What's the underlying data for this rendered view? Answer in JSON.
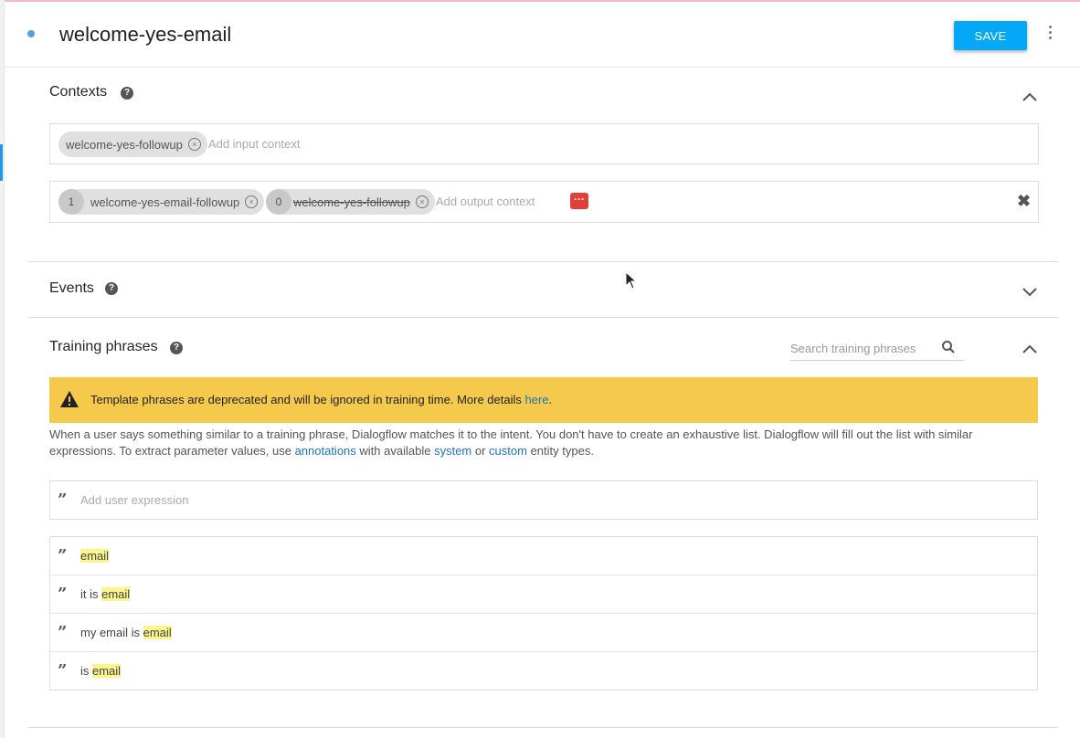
{
  "header": {
    "intent_name": "welcome-yes-email",
    "save_label": "SAVE",
    "more_icon": "more-vertical-icon"
  },
  "contexts": {
    "title": "Contexts",
    "input_contexts": [
      {
        "name": "welcome-yes-followup"
      }
    ],
    "input_placeholder": "Add input context",
    "output_contexts": [
      {
        "lifespan": "1",
        "name": "welcome-yes-email-followup",
        "strikethrough": false
      },
      {
        "lifespan": "0",
        "name": "welcome-yes-followup",
        "strikethrough": true
      }
    ],
    "output_placeholder": "Add output context",
    "more_button_icon": "ellipsis-icon",
    "clear_icon": "close-icon"
  },
  "events": {
    "title": "Events"
  },
  "training": {
    "title": "Training phrases",
    "search_placeholder": "Search training phrases",
    "warning": {
      "text": "Template phrases are deprecated and will be ignored in training time. More details ",
      "link": "here",
      "suffix": "."
    },
    "description": {
      "part1": "When a user says something similar to a training phrase, Dialogflow matches it to the intent. You don't have to create an exhaustive list. Dialogflow will fill out the list with similar expressions. To extract parameter values, use ",
      "link_annotations": "annotations",
      "part2": " with available ",
      "link_system": "system",
      "part3": " or ",
      "link_custom": "custom",
      "part4": " entity types."
    },
    "add_placeholder": "Add user expression",
    "phrases": [
      {
        "prefix": "",
        "highlight": "email"
      },
      {
        "prefix": "it is ",
        "highlight": "email"
      },
      {
        "prefix": "my email is ",
        "highlight": "email"
      },
      {
        "prefix": "is ",
        "highlight": "email"
      }
    ],
    "highlight_color": "#fbf58e"
  },
  "colors": {
    "accent": "#03a9f4",
    "warning": "#f5c94c",
    "status_dot": "#4ea3e8"
  }
}
